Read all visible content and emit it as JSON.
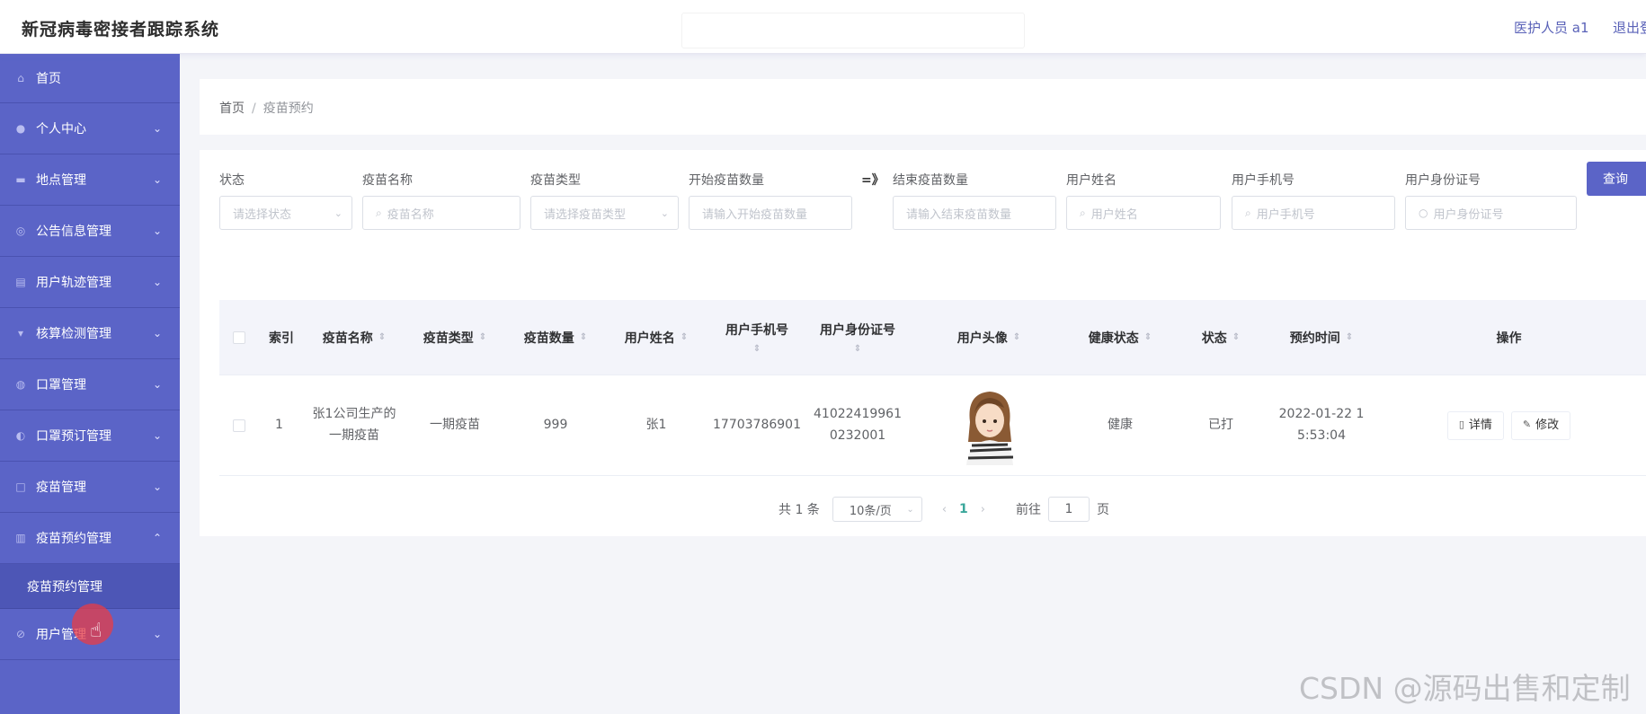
{
  "header": {
    "title": "新冠病毒密接者跟踪系统",
    "user": "医护人员 a1",
    "logout": "退出登"
  },
  "sidebar": {
    "items": [
      {
        "label": "首页",
        "icon": "home-icon"
      },
      {
        "label": "个人中心",
        "icon": "user-icon"
      },
      {
        "label": "地点管理",
        "icon": "monitor-icon"
      },
      {
        "label": "公告信息管理",
        "icon": "globe-icon"
      },
      {
        "label": "用户轨迹管理",
        "icon": "clipboard-icon"
      },
      {
        "label": "核算检测管理",
        "icon": "test-icon"
      },
      {
        "label": "口罩管理",
        "icon": "mask-icon"
      },
      {
        "label": "口罩预订管理",
        "icon": "power-icon"
      },
      {
        "label": "疫苗管理",
        "icon": "square-icon"
      },
      {
        "label": "疫苗预约管理",
        "icon": "chart-icon"
      },
      {
        "label": "用户管理",
        "icon": "user-manage-icon"
      }
    ],
    "submenu": "疫苗预约管理"
  },
  "breadcrumb": {
    "home": "首页",
    "sep": "/",
    "current": "疫苗预约"
  },
  "filters": {
    "status": {
      "label": "状态",
      "placeholder": "请选择状态"
    },
    "vaccine_name": {
      "label": "疫苗名称",
      "placeholder": "疫苗名称"
    },
    "vaccine_type": {
      "label": "疫苗类型",
      "placeholder": "请选择疫苗类型"
    },
    "start_qty": {
      "label": "开始疫苗数量",
      "placeholder": "请输入开始疫苗数量"
    },
    "range_sep": "=》",
    "end_qty": {
      "label": "结束疫苗数量",
      "placeholder": "请输入结束疫苗数量"
    },
    "user_name": {
      "label": "用户姓名",
      "placeholder": "用户姓名"
    },
    "user_phone": {
      "label": "用户手机号",
      "placeholder": "用户手机号"
    },
    "user_id": {
      "label": "用户身份证号",
      "placeholder": "用户身份证号"
    },
    "query_label": "查询"
  },
  "table": {
    "headers": {
      "index": "索引",
      "vaccine_name": "疫苗名称",
      "vaccine_type": "疫苗类型",
      "vaccine_qty": "疫苗数量",
      "user_name": "用户姓名",
      "user_phone": "用户手机号",
      "user_id": "用户身份证号",
      "avatar": "用户头像",
      "health": "健康状态",
      "status": "状态",
      "time": "预约时间",
      "ops": "操作"
    },
    "rows": [
      {
        "index": "1",
        "vaccine_name_1": "张1公司生产的",
        "vaccine_name_2": "一期疫苗",
        "vaccine_type": "一期疫苗",
        "vaccine_qty": "999",
        "user_name": "张1",
        "user_phone": "17703786901",
        "user_id_1": "41022419961",
        "user_id_2": "0232001",
        "health": "健康",
        "status": "已打",
        "time_1": "2022-01-22 1",
        "time_2": "5:53:04",
        "detail_label": "详情",
        "edit_label": "修改"
      }
    ]
  },
  "pagination": {
    "total": "共 1 条",
    "page_size": "10条/页",
    "current_page": "1",
    "goto_label": "前往",
    "goto_value": "1",
    "page_suffix": "页"
  },
  "watermark": "CSDN @源码出售和定制"
}
